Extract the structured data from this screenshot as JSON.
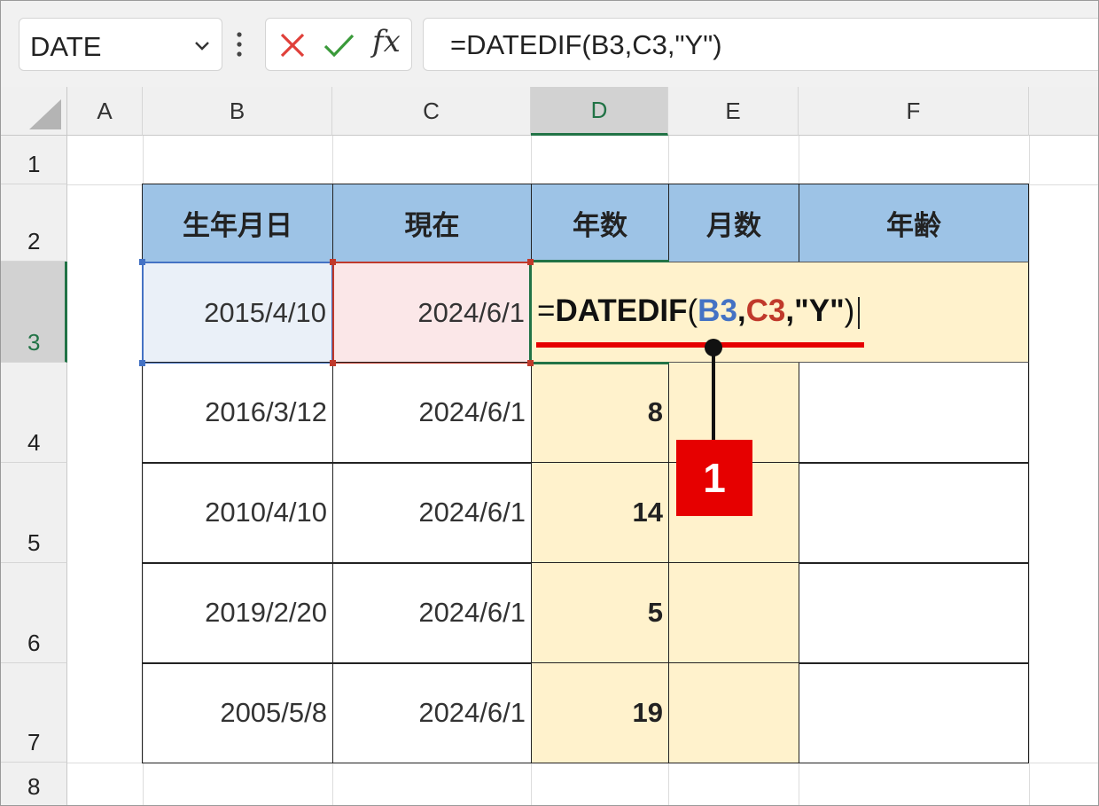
{
  "formula_bar": {
    "name_box": "DATE",
    "formula": "=DATEDIF(B3,C3,\"Y\")"
  },
  "columns": [
    "A",
    "B",
    "C",
    "D",
    "E",
    "F"
  ],
  "rows": [
    "1",
    "2",
    "3",
    "4",
    "5",
    "6",
    "7",
    "8"
  ],
  "table": {
    "headers": [
      "生年月日",
      "現在",
      "年数",
      "月数",
      "年齢"
    ],
    "rows": [
      {
        "birth": "2015/4/10",
        "now": "2024/6/1",
        "years": ""
      },
      {
        "birth": "2016/3/12",
        "now": "2024/6/1",
        "years": "8"
      },
      {
        "birth": "2010/4/10",
        "now": "2024/6/1",
        "years": "14"
      },
      {
        "birth": "2019/2/20",
        "now": "2024/6/1",
        "years": "5"
      },
      {
        "birth": "2005/5/8",
        "now": "2024/6/1",
        "years": "19"
      }
    ]
  },
  "edit_cell": {
    "eq": "=",
    "fn": "DATEDIF",
    "lp": "(",
    "ref1": "B3",
    "comma1": ",",
    "ref2": "C3",
    "rest": ",\"Y\"",
    "rp": ")"
  },
  "callout": {
    "label": "1"
  },
  "colors": {
    "accent_green": "#217346",
    "header_blue": "#9dc3e6",
    "highlight_yellow": "#fff2cc",
    "callout_red": "#e60000",
    "ref_blue": "#4472c4",
    "ref_red": "#c0392b"
  }
}
